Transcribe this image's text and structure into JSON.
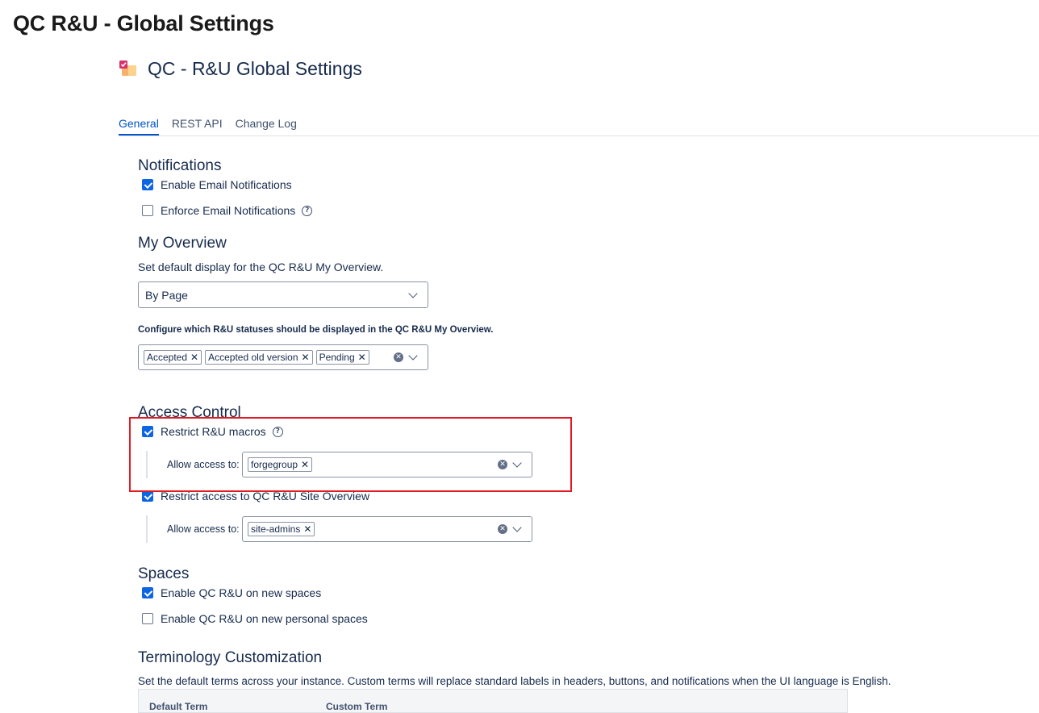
{
  "page": {
    "title": "QC R&U - Global Settings"
  },
  "app": {
    "title": "QC - R&U Global Settings",
    "logo_icon": "qc-ru-app-icon"
  },
  "tabs": [
    {
      "label": "General",
      "active": true
    },
    {
      "label": "REST API",
      "active": false
    },
    {
      "label": "Change Log",
      "active": false
    }
  ],
  "notifications": {
    "heading": "Notifications",
    "enable_email": {
      "label": "Enable Email Notifications",
      "checked": true
    },
    "enforce_email": {
      "label": "Enforce Email Notifications",
      "checked": false
    }
  },
  "my_overview": {
    "heading": "My Overview",
    "description": "Set default display for the QC R&U My Overview.",
    "display_select": {
      "value": "By Page"
    },
    "statuses_label": "Configure which R&U statuses should be displayed in the QC R&U My Overview.",
    "statuses": [
      "Accepted",
      "Accepted old version",
      "Pending"
    ]
  },
  "access_control": {
    "heading": "Access Control",
    "restrict_macros": {
      "label": "Restrict R&U macros",
      "checked": true,
      "allow_label": "Allow access to:",
      "groups": [
        "forgegroup"
      ]
    },
    "restrict_site_overview": {
      "label": "Restrict access to QC R&U Site Overview",
      "checked": true,
      "allow_label": "Allow access to:",
      "groups": [
        "site-admins"
      ]
    }
  },
  "spaces": {
    "heading": "Spaces",
    "new_spaces": {
      "label": "Enable QC R&U on new spaces",
      "checked": true
    },
    "new_personal_spaces": {
      "label": "Enable QC R&U on new personal spaces",
      "checked": false
    }
  },
  "terminology": {
    "heading": "Terminology Customization",
    "description": "Set the default terms across your instance. Custom terms will replace standard labels in headers, buttons, and notifications when the UI language is English.",
    "columns": [
      "Default Term",
      "Custom Term"
    ]
  },
  "colors": {
    "accent": "#0c66e4",
    "highlight": "#e01b24"
  }
}
